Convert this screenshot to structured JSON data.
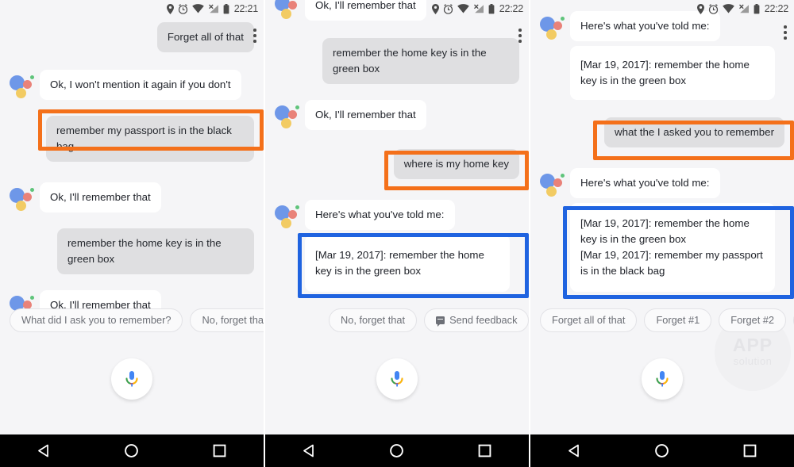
{
  "statusbar": {
    "time_panel1": "22:21",
    "time_panel2": "22:22",
    "time_panel3": "22:22",
    "icons": [
      "location-pin-icon",
      "alarm-clock-icon",
      "wifi-icon",
      "no-sim-signal-icon",
      "battery-icon"
    ]
  },
  "colors": {
    "highlight_orange": "#f4701a",
    "highlight_blue": "#1f63e0",
    "user_bubble": "#dfdfe1",
    "bot_bubble": "#ffffff",
    "screen_bg": "#f5f5f7",
    "navbar": "#000000",
    "logo_blue": "#6e97e8",
    "logo_red": "#e98279",
    "logo_yellow": "#f2cb63",
    "logo_green": "#5fc47b"
  },
  "panel1": {
    "messages": {
      "m1_user_forget_all": "Forget all of that",
      "m2_bot_wont_mention": "Ok, I won't mention it again if you don't",
      "m3_user_passport": "remember my passport is in the black bag",
      "m4_bot_remember": "Ok, I'll remember that",
      "m5_user_homekey": "remember the home key is in the green box",
      "m6_bot_remember": "Ok, I'll remember that"
    },
    "chips": [
      {
        "label": "What did I ask you to remember?",
        "icon": null
      },
      {
        "label": "No, forget that",
        "icon": null
      }
    ]
  },
  "panel2": {
    "messages": {
      "m1_bot_remember_cut": "Ok, I'll remember that",
      "m2_user_homekey": "remember the home key is in the green box",
      "m3_bot_remember": "Ok, I'll remember that",
      "m4_user_where_homekey": "where is my home key",
      "m5_bot_heres_what": "Here's what you've told me:",
      "m6_bot_memo": "[Mar 19, 2017]: remember the home key is in the green box"
    },
    "chips": [
      {
        "label": "No, forget that",
        "icon": null
      },
      {
        "label": "Send feedback",
        "icon": "feedback-icon"
      }
    ]
  },
  "panel3": {
    "messages": {
      "m1_bot_heres_what": "Here's what you've told me:",
      "m2_bot_memo_single": "[Mar 19, 2017]: remember the home key is in the green box",
      "m3_user_what_asked": "what the I asked you to remember",
      "m4_bot_heres_what": "Here's what you've told me:",
      "m5_bot_memo_line1": "[Mar 19, 2017]: remember the home key is in the green box",
      "m5_bot_memo_line2": "[Mar 19, 2017]: remember my passport is in the black bag"
    },
    "chips": [
      {
        "label": "Forget all of that",
        "icon": null
      },
      {
        "label": "Forget #1",
        "icon": null
      },
      {
        "label": "Forget #2",
        "icon": null
      },
      {
        "label": "",
        "icon": "feedback-icon"
      }
    ],
    "watermark": {
      "line1": "APP",
      "line2": "solution"
    }
  },
  "navbar": {
    "back_label": "back-button",
    "home_label": "home-button",
    "recents_label": "recents-button"
  },
  "mic": {
    "label": "microphone-button"
  }
}
